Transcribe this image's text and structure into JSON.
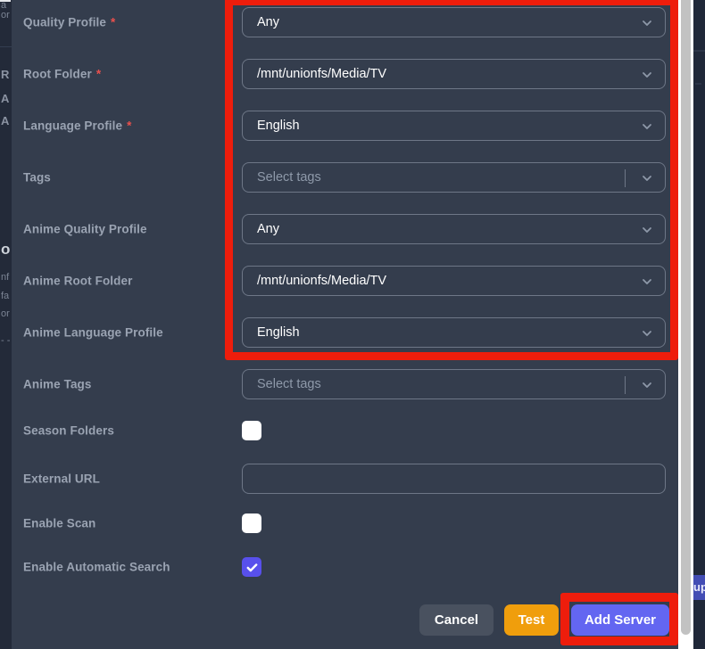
{
  "colors": {
    "annotation_red": "#ee1d0c",
    "modal_background": "#343d4d",
    "page_background": "#232a39",
    "checkbox_checked_indigo": "#5850ec",
    "add_server_indigo": "#6366f1",
    "test_amber": "#f09e0c",
    "cancel_gray": "#49515f",
    "label_gray": "#9aa3b2",
    "field_border_gray": "#6e7787"
  },
  "modal": {
    "required_marker": "*",
    "fields": [
      {
        "label": "Quality Profile",
        "required": true,
        "type": "select",
        "value": "Any"
      },
      {
        "label": "Root Folder",
        "required": true,
        "type": "select",
        "value": "/mnt/unionfs/Media/TV"
      },
      {
        "label": "Language Profile",
        "required": true,
        "type": "select",
        "value": "English"
      },
      {
        "label": "Tags",
        "required": false,
        "type": "multiselect",
        "placeholder": "Select tags"
      },
      {
        "label": "Anime Quality Profile",
        "required": false,
        "type": "select",
        "value": "Any"
      },
      {
        "label": "Anime Root Folder",
        "required": false,
        "type": "select",
        "value": "/mnt/unionfs/Media/TV"
      },
      {
        "label": "Anime Language Profile",
        "required": false,
        "type": "select",
        "value": "English"
      },
      {
        "label": "Anime Tags",
        "required": false,
        "type": "multiselect",
        "placeholder": "Select tags"
      },
      {
        "label": "Season Folders",
        "required": false,
        "type": "checkbox",
        "checked": false
      },
      {
        "label": "External URL",
        "required": false,
        "type": "text",
        "value": ""
      },
      {
        "label": "Enable Scan",
        "required": false,
        "type": "checkbox",
        "checked": false
      },
      {
        "label": "Enable Automatic Search",
        "required": false,
        "type": "checkbox",
        "checked": true
      }
    ],
    "buttons": {
      "cancel": "Cancel",
      "test": "Test",
      "add_server": "Add Server"
    }
  },
  "background": {
    "left_fragments": [
      {
        "text": "a"
      },
      {
        "text": "or"
      },
      {
        "text": "R"
      },
      {
        "text": "A"
      },
      {
        "text": "A"
      },
      {
        "text": "o"
      },
      {
        "text": "nf"
      },
      {
        "text": "fa"
      },
      {
        "text": "or"
      },
      {
        "text": "- -"
      }
    ],
    "right_fragment": "up"
  }
}
